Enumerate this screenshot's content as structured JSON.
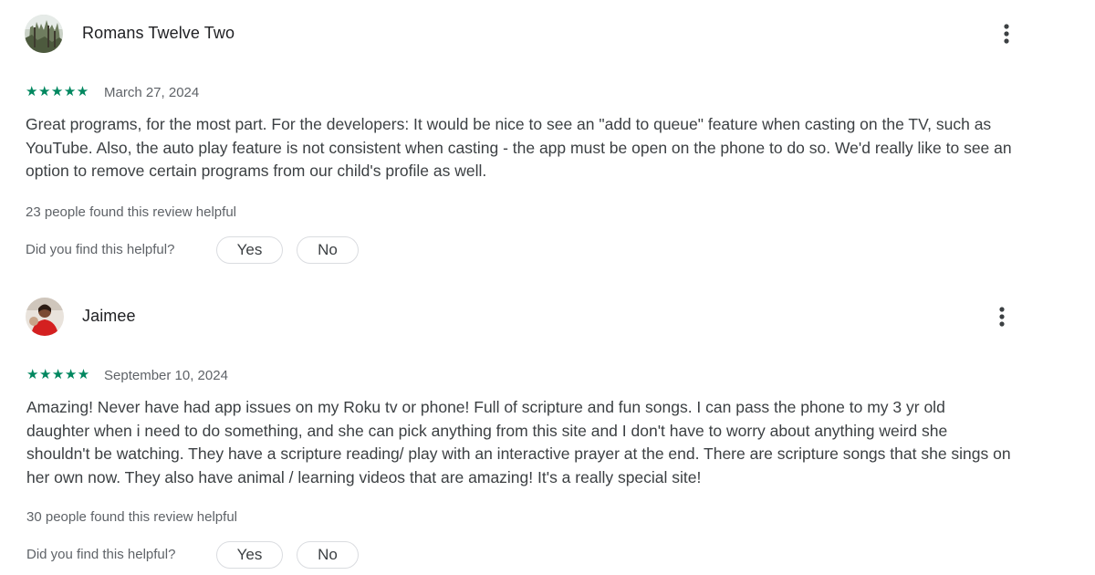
{
  "reviews": [
    {
      "author": "Romans Twelve Two",
      "stars": "★★★★★",
      "rating": 5,
      "date": "March 27, 2024",
      "text": "Great programs, for the most part. For the developers: It would be nice to see an \"add to queue\" feature when casting on the TV, such as YouTube. Also, the auto play feature is not consistent when casting - the app must be open on the phone to do so. We'd really like to see an option to remove certain programs from our child's profile as well.",
      "helpful_count": "23 people found this review helpful",
      "helpful_question": "Did you find this helpful?",
      "yes_label": "Yes",
      "no_label": "No"
    },
    {
      "author": "Jaimee",
      "stars": "★★★★★",
      "rating": 5,
      "date": "September 10, 2024",
      "text": "Amazing! Never have had app issues on my Roku tv or phone! Full of scripture and fun songs. I can pass the phone to my 3 yr old daughter when i need to do something, and she can pick anything from this site and I don't have to worry about anything weird she shouldn't be watching. They have a scripture reading/ play with an interactive prayer at the end. There are scripture songs that she sings on her own now. They also have animal / learning videos that are amazing! It's a really special site!",
      "helpful_count": "30 people found this review helpful",
      "helpful_question": "Did you find this helpful?",
      "yes_label": "Yes",
      "no_label": "No"
    }
  ],
  "colors": {
    "star": "#01875f",
    "text": "#3c4043",
    "secondary_text": "#5f6368",
    "border": "#dadce0"
  },
  "icons": {
    "more": "more-vert-icon"
  }
}
